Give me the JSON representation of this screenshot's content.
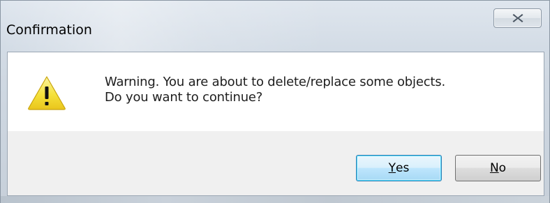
{
  "window": {
    "title": "Confirmation",
    "close_icon": "close-icon"
  },
  "dialog": {
    "icon": "warning-icon",
    "message_line1": "Warning. You are about to delete/replace some objects.",
    "message_line2": "Do you want to continue?"
  },
  "buttons": {
    "yes": {
      "mnemonic": "Y",
      "rest": "es"
    },
    "no": {
      "mnemonic": "N",
      "rest": "o"
    }
  },
  "colors": {
    "warning_yellow": "#f5e13a",
    "default_button_border": "#3c7fb1"
  }
}
